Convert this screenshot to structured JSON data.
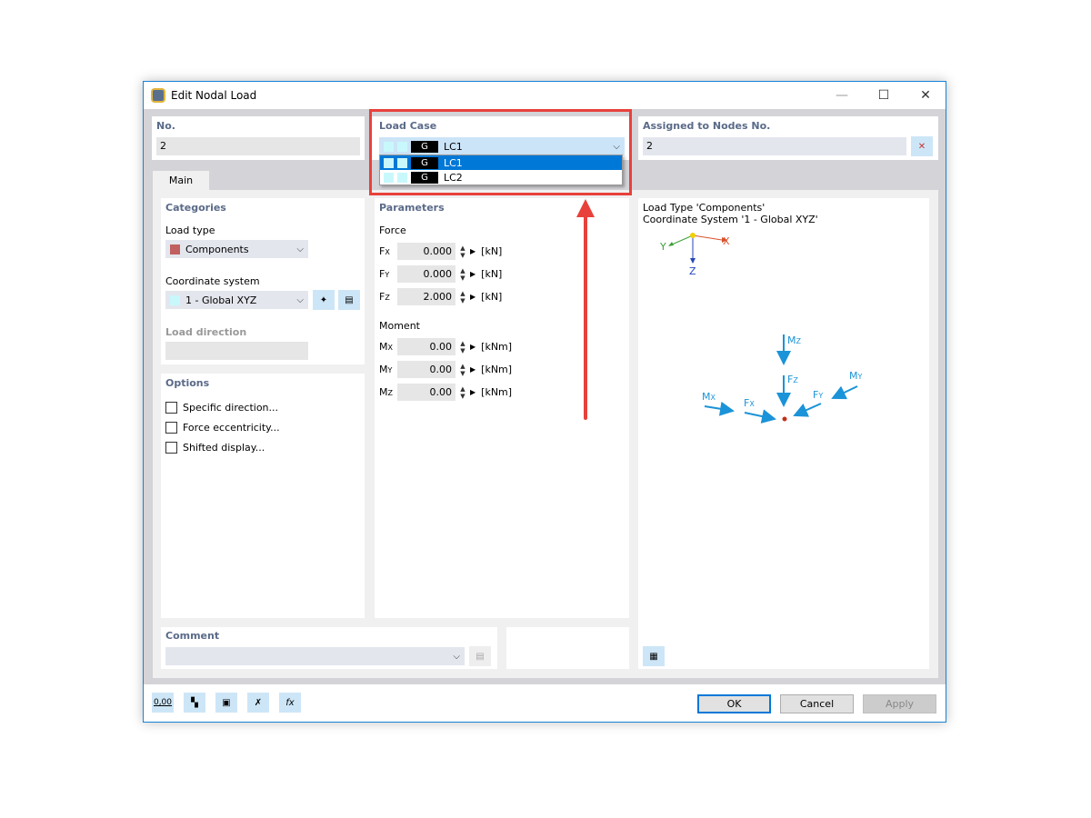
{
  "window": {
    "title": "Edit Nodal Load",
    "minimize": "—",
    "maximize": "☐",
    "close": "✕"
  },
  "no": {
    "label": "No.",
    "value": "2"
  },
  "load_case": {
    "label": "Load Case",
    "selected": {
      "type": "G",
      "name": "LC1"
    },
    "options": [
      {
        "type": "G",
        "name": "LC1",
        "highlighted": true
      },
      {
        "type": "G",
        "name": "LC2",
        "highlighted": false
      }
    ]
  },
  "assigned": {
    "label": "Assigned to Nodes No.",
    "value": "2"
  },
  "tabs": [
    {
      "label": "Main",
      "active": true
    }
  ],
  "categories": {
    "title": "Categories",
    "load_type_label": "Load type",
    "load_type": "Components",
    "load_type_color": "#c06060",
    "coord_label": "Coordinate system",
    "coord": "1 - Global XYZ",
    "direction_label": "Load direction",
    "direction": ""
  },
  "options": {
    "title": "Options",
    "items": [
      {
        "label": "Specific direction...",
        "checked": false
      },
      {
        "label": "Force eccentricity...",
        "checked": false
      },
      {
        "label": "Shifted display...",
        "checked": false
      }
    ]
  },
  "parameters": {
    "title": "Parameters",
    "force": {
      "label": "Force",
      "rows": [
        {
          "sym": "F",
          "sub": "X",
          "value": "0.000",
          "unit": "[kN]"
        },
        {
          "sym": "F",
          "sub": "Y",
          "value": "0.000",
          "unit": "[kN]"
        },
        {
          "sym": "F",
          "sub": "Z",
          "value": "2.000",
          "unit": "[kN]"
        }
      ]
    },
    "moment": {
      "label": "Moment",
      "rows": [
        {
          "sym": "M",
          "sub": "X",
          "value": "0.00",
          "unit": "[kNm]"
        },
        {
          "sym": "M",
          "sub": "Y",
          "value": "0.00",
          "unit": "[kNm]"
        },
        {
          "sym": "M",
          "sub": "Z",
          "value": "0.00",
          "unit": "[kNm]"
        }
      ]
    }
  },
  "graphic": {
    "line1": "Load Type 'Components'",
    "line2": "Coordinate System '1 - Global XYZ'",
    "axes": {
      "x": "X",
      "y": "Y",
      "z": "Z"
    },
    "labels": {
      "mz": "M",
      "mz_sub": "Z",
      "fz": "F",
      "fz_sub": "Z",
      "mx": "M",
      "mx_sub": "X",
      "fx": "F",
      "fx_sub": "X",
      "fy": "F",
      "fy_sub": "Y",
      "my": "M",
      "my_sub": "Y"
    }
  },
  "comment": {
    "label": "Comment",
    "value": ""
  },
  "footer": {
    "ok": "OK",
    "cancel": "Cancel",
    "apply": "Apply",
    "units_icon_text": "0,00",
    "func_icon_text": "fx"
  },
  "colors": {
    "accent": "#0078d7",
    "highlight_box": "#e8413c",
    "load_arrow": "#1b93d8"
  }
}
